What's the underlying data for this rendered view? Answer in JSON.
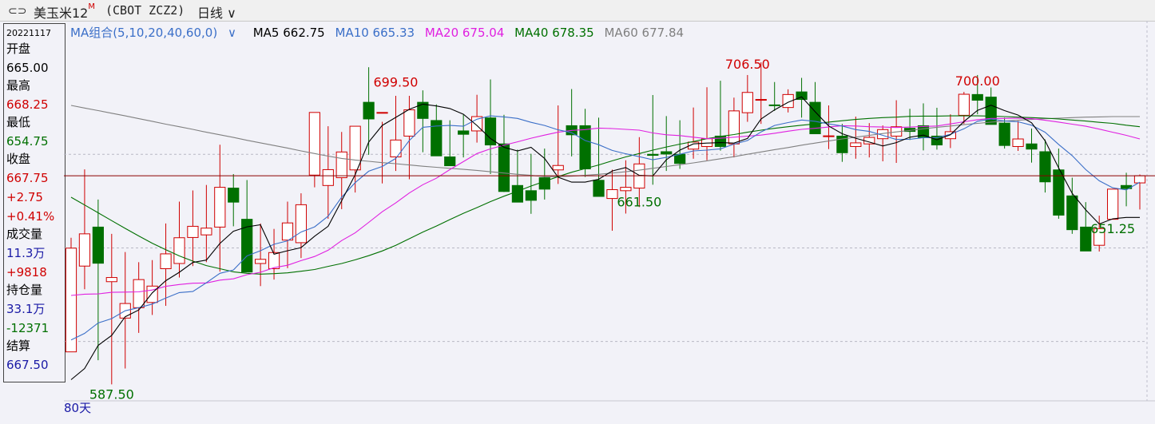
{
  "header": {
    "link_icon": "link-icon",
    "instrument": "美玉米12",
    "instrument_sup": "M",
    "code": "(CBOT ZCZ2)",
    "period": "日线",
    "period_icon": "chevron-down-icon"
  },
  "info": {
    "date": "20221117",
    "open_label": "开盘",
    "open": "665.00",
    "high_label": "最高",
    "high": "668.25",
    "low_label": "最低",
    "low": "654.75",
    "close_label": "收盘",
    "close": "667.75",
    "change": "+2.75",
    "change_pct": "+0.41%",
    "volume_label": "成交量",
    "volume": "11.3万",
    "volume_change": "+9818",
    "oi_label": "持仓量",
    "oi": "33.1万",
    "oi_change": "-12371",
    "settle_label": "结算",
    "settle": "667.50"
  },
  "legend": {
    "group": "MA组合(5,10,20,40,60,0)",
    "ma5": "MA5 662.75",
    "ma10": "MA10 665.33",
    "ma20": "MA20 675.04",
    "ma40": "MA40 678.35",
    "ma60": "MA60 677.84"
  },
  "colors": {
    "up": "#d00000",
    "down": "#007000",
    "ma5": "#000000",
    "ma10": "#3b6fc8",
    "ma20": "#e020e0",
    "ma40": "#007000",
    "ma60": "#808080",
    "crosshair": "#8b0000"
  },
  "period_label": "80天",
  "chart_data": {
    "type": "candlestick",
    "y_range": [
      583,
      720
    ],
    "crosshair_price": 667.75,
    "annotations": [
      {
        "text": "699.50",
        "index": 24,
        "price": 699.5,
        "kind": "high"
      },
      {
        "text": "706.50",
        "index": 50,
        "price": 706.5,
        "kind": "high"
      },
      {
        "text": "700.00",
        "index": 67,
        "price": 700.0,
        "kind": "high"
      },
      {
        "text": "661.50",
        "index": 42,
        "price": 661.5,
        "kind": "low"
      },
      {
        "text": "651.25",
        "index": 77,
        "price": 651.25,
        "kind": "low"
      },
      {
        "text": "587.50",
        "index": 3,
        "price": 587.5,
        "kind": "low"
      }
    ],
    "ohlc": [
      [
        600,
        643.9,
        631.9,
        639.9
      ],
      [
        633,
        670.2,
        624.1,
        645.4
      ],
      [
        648,
        658.6,
        596.8,
        634.1
      ],
      [
        627,
        645.4,
        587.5,
        628.6
      ],
      [
        613,
        638.4,
        593.6,
        618.6
      ],
      [
        617,
        634.5,
        607.3,
        627.8
      ],
      [
        619,
        635.3,
        614.2,
        625.3
      ],
      [
        632,
        649.4,
        617.7,
        637.7
      ],
      [
        634,
        657.8,
        628.6,
        643.9
      ],
      [
        644,
        662.1,
        633,
        648.3
      ],
      [
        645,
        664.2,
        634.5,
        647.6
      ],
      [
        648,
        679.7,
        630.9,
        663.3
      ],
      [
        663,
        668.4,
        648.3,
        657.6
      ],
      [
        651,
        666.1,
        631.2,
        630.7
      ],
      [
        634,
        649.4,
        625.3,
        635.6
      ],
      [
        632,
        647.3,
        627.8,
        638.2
      ],
      [
        643,
        657.8,
        632.2,
        649.6
      ],
      [
        642,
        661,
        636.1,
        656.6
      ],
      [
        668,
        690.1,
        663.3,
        692.1
      ],
      [
        664,
        686.8,
        651.2,
        670.1
      ],
      [
        667,
        684.6,
        654.9,
        676.9
      ],
      [
        670,
        685.8,
        661.3,
        686.8
      ],
      [
        696,
        709.5,
        675.8,
        689.6
      ],
      [
        692,
        688.5,
        664.8,
        692.1
      ],
      [
        675,
        698.5,
        669.6,
        681.5
      ],
      [
        683,
        698.5,
        666.4,
        693.1
      ],
      [
        696,
        700.6,
        676.8,
        689.8
      ],
      [
        689,
        695.2,
        675.9,
        675.4
      ],
      [
        675,
        689.1,
        672.2,
        671.6
      ],
      [
        685,
        691.2,
        674.8,
        683.7
      ],
      [
        685,
        698.9,
        680.5,
        690.5
      ],
      [
        690,
        704.8,
        668.4,
        679.6
      ],
      [
        680,
        691.2,
        661.5,
        661.7
      ],
      [
        664,
        677.8,
        657.6,
        657.6
      ],
      [
        662,
        676.2,
        653.1,
        658.3
      ],
      [
        667,
        678.2,
        658.6,
        662.6
      ],
      [
        670,
        694.8,
        664.6,
        671.7
      ],
      [
        687,
        701.1,
        675.2,
        683.5
      ],
      [
        687,
        693.5,
        667.3,
        670.4
      ],
      [
        666,
        690.1,
        660,
        659.8
      ],
      [
        659,
        670.1,
        646.6,
        662.4
      ],
      [
        662,
        673.7,
        653.2,
        663.3
      ],
      [
        663,
        682.6,
        655.7,
        672.3
      ],
      [
        676,
        698.8,
        664.3,
        675.6
      ],
      [
        677,
        690.7,
        669.6,
        676.1
      ],
      [
        676,
        689.1,
        670.4,
        672.5
      ],
      [
        678,
        694,
        674.3,
        680.7
      ],
      [
        679,
        701.8,
        673.7,
        682
      ],
      [
        683,
        704.3,
        677.4,
        679
      ],
      [
        680,
        697.8,
        674.8,
        692.7
      ],
      [
        692,
        706.5,
        688.5,
        699.8
      ],
      [
        697,
        711.4,
        687.7,
        697.1
      ],
      [
        695,
        703.8,
        692.7,
        694.8
      ],
      [
        694,
        701,
        692.1,
        699
      ],
      [
        700,
        705.4,
        690.1,
        697.1
      ],
      [
        696,
        703.8,
        685.3,
        683.9
      ],
      [
        683,
        694.8,
        678,
        683.1
      ],
      [
        683,
        687.7,
        673.1,
        676.6
      ],
      [
        679,
        690.5,
        674.3,
        680.4
      ],
      [
        680,
        688,
        674.8,
        682.5
      ],
      [
        682,
        687.1,
        673.3,
        685.5
      ],
      [
        683,
        696.8,
        672.7,
        686.6
      ],
      [
        686,
        693.5,
        681.5,
        684.8
      ],
      [
        687,
        695.6,
        677.5,
        682.5
      ],
      [
        683,
        693.9,
        677.8,
        679.6
      ],
      [
        682,
        691.4,
        678.4,
        684.7
      ],
      [
        691,
        700,
        687.7,
        699.1
      ],
      [
        699,
        706.5,
        691.4,
        696.8
      ],
      [
        698,
        701.7,
        688.5,
        687.5
      ],
      [
        688,
        690.1,
        678.2,
        679.4
      ],
      [
        679,
        688.8,
        677.3,
        681.9
      ],
      [
        680,
        685.9,
        672.8,
        678
      ],
      [
        677,
        681.7,
        661.3,
        665.4
      ],
      [
        670,
        678.2,
        651.2,
        652.6
      ],
      [
        660,
        667,
        645.4,
        647
      ],
      [
        648,
        657.6,
        639.5,
        638.8
      ],
      [
        641,
        652.4,
        638.6,
        647.4
      ],
      [
        651,
        657.8,
        651.25,
        662.6
      ],
      [
        664,
        668.9,
        656,
        662.8
      ],
      [
        665,
        668.25,
        654.75,
        667.75
      ]
    ],
    "ma_series": {
      "ma5": [
        589.3,
        593.6,
        602.5,
        606.3,
        613.5,
        616.1,
        622.7,
        627.4,
        630.6,
        634.4,
        635.3,
        641.7,
        646.4,
        648.1,
        648.9,
        637.6,
        638.9,
        640.1,
        644.5,
        648.3,
        658.1,
        668.2,
        680.7,
        687.1,
        690.2,
        693.3,
        695.3,
        694.6,
        693.6,
        691.4,
        687.1,
        682.1,
        678.7,
        677.3,
        678.7,
        674.4,
        667.2,
        665.3,
        665.3,
        666.4,
        669.6,
        670.9,
        667.9,
        667.7,
        673.9,
        677.6,
        680,
        680.3,
        680.5,
        680.3,
        682.1,
        689.6,
        693.1,
        696,
        698.1,
        692.4,
        686.9,
        683.9,
        682.2,
        680.7,
        679.2,
        680.5,
        682.6,
        683.4,
        681.6,
        683.5,
        688.6,
        692.9,
        694.9,
        692.8,
        691.1,
        688.1,
        681.2,
        670.8,
        661,
        654.6,
        649.2,
        651.2,
        651.7,
        651.7
      ],
      "ma10": [
        604.6,
        607.1,
        611.1,
        612.8,
        615.8,
        617,
        618.4,
        620.7,
        622.8,
        623.2,
        626.6,
        630.2,
        631.5,
        636.9,
        638.9,
        641.4,
        642.7,
        646.1,
        648.1,
        652.2,
        659.5,
        665.1,
        669.5,
        671.3,
        674.4,
        681.3,
        686.4,
        686.9,
        687.1,
        686.8,
        689.5,
        690.8,
        690.4,
        689.8,
        688.3,
        687.1,
        685.4,
        684.3,
        681.3,
        679.7,
        677.5,
        676.2,
        675.1,
        673.9,
        674.8,
        676,
        677.3,
        677.6,
        678.1,
        679.9,
        681.3,
        684.6,
        687.1,
        688.2,
        689.2,
        688.7,
        687.7,
        686.9,
        685.5,
        684.8,
        683.3,
        681.7,
        681.8,
        682.4,
        682.4,
        683.7,
        685.8,
        688.7,
        689.6,
        688.8,
        688.5,
        687.2,
        684.5,
        679.8,
        675.5,
        670.1,
        665.8,
        663.1,
        662.3,
        665.3
      ],
      "ma20": [
        621.7,
        622.2,
        622.3,
        622.9,
        623,
        623.1,
        623.8,
        625.2,
        625.9,
        626.4,
        626.5,
        627.6,
        628.1,
        629.7,
        630.6,
        632.4,
        633.3,
        635.1,
        636.7,
        639.1,
        642.8,
        645.8,
        649.8,
        653.9,
        657.3,
        661.1,
        664.3,
        666.8,
        670.1,
        673.2,
        676.3,
        678.1,
        679.5,
        680.8,
        682.2,
        683.4,
        684.5,
        685.2,
        685.5,
        686.1,
        685.9,
        685.6,
        685.3,
        684.2,
        683.5,
        683.2,
        682.6,
        682,
        682.2,
        682.6,
        683,
        683.4,
        684.1,
        684.9,
        685.6,
        686,
        686.5,
        687,
        686.9,
        686.6,
        686.5,
        686.3,
        686.5,
        686.7,
        686.9,
        687.7,
        688.5,
        689.3,
        689.8,
        689.8,
        689.9,
        689.7,
        689.1,
        688.4,
        687.6,
        686.8,
        685.7,
        684.5,
        683.3,
        681.9
      ],
      "ma40": [
        659.5,
        656.5,
        653.5,
        650.5,
        647.5,
        644.6,
        641.8,
        639.3,
        636.9,
        634.9,
        633.2,
        632,
        630.8,
        630.2,
        629.9,
        630.1,
        630.4,
        631,
        631.7,
        632.9,
        634,
        635.4,
        637,
        638.8,
        641,
        643.5,
        646.1,
        648.4,
        650.9,
        653.3,
        655.5,
        657.8,
        659.9,
        661.8,
        663.8,
        665.6,
        667.4,
        669.1,
        670.5,
        671.9,
        673.5,
        675,
        676.3,
        677.6,
        678.8,
        679.9,
        680.9,
        682,
        682.9,
        683.6,
        684.5,
        685.3,
        686,
        686.6,
        687.2,
        687.7,
        688.4,
        688.9,
        689.4,
        689.8,
        690.1,
        690.3,
        690.6,
        690.7,
        690.7,
        690.8,
        690.8,
        690.8,
        690.7,
        690.5,
        690.3,
        690.1,
        689.9,
        689.6,
        689.2,
        688.8,
        688.3,
        687.9,
        687.2,
        686.6
      ],
      "ma60": [
        694.8,
        693.8,
        692.8,
        691.8,
        690.8,
        689.7,
        688.7,
        687.6,
        686.6,
        685.6,
        684.5,
        683.5,
        682.5,
        681.4,
        680.4,
        679.4,
        678.4,
        677.3,
        676.3,
        675.3,
        674.4,
        673.8,
        673.3,
        672.8,
        672.4,
        671.9,
        671.4,
        671,
        670.6,
        670.2,
        669.8,
        669.3,
        668.8,
        668.3,
        667.9,
        667.4,
        667.4,
        667.6,
        667.9,
        668.3,
        668.8,
        669.3,
        669.9,
        670.6,
        671.3,
        672,
        672.7,
        673.5,
        674.3,
        675.1,
        676,
        676.9,
        677.8,
        678.6,
        679.5,
        680.3,
        681.1,
        681.9,
        682.6,
        683.3,
        684,
        684.6,
        685.2,
        685.8,
        686.4,
        686.9,
        687.4,
        687.9,
        688.4,
        688.8,
        689.1,
        689.4,
        689.7,
        689.9,
        690.1,
        690.3,
        690.4,
        690.5,
        690.5,
        690.5
      ]
    }
  }
}
